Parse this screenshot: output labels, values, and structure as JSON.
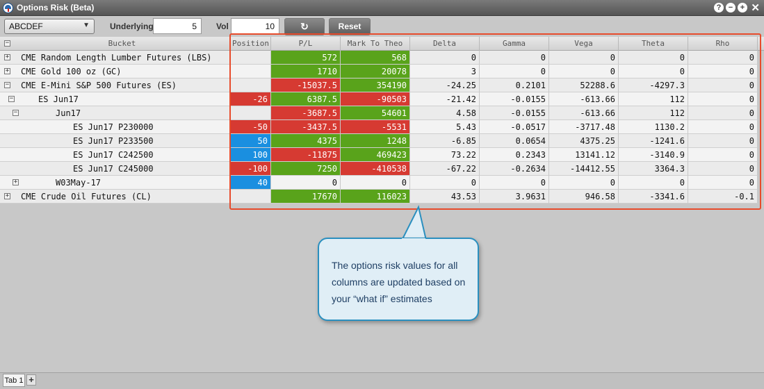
{
  "window": {
    "title": "Options Risk (Beta)",
    "help_icon": "?",
    "min_icon": "−",
    "max_icon": "+",
    "close_icon": "✕"
  },
  "toolbar": {
    "symbol_selected": "ABCDEF",
    "underlying_label": "Underlying",
    "underlying_value": "5",
    "vol_label": "Vol",
    "vol_value": "10",
    "refresh_icon": "↻",
    "reset_label": "Reset"
  },
  "grid": {
    "header_toggle": "−",
    "columns": [
      "Bucket",
      "Position",
      "P/L",
      "Mark To Theo",
      "Delta",
      "Gamma",
      "Vega",
      "Theta",
      "Rho"
    ],
    "rows": [
      {
        "label": "CME Random Length Lumber Futures (LBS)",
        "toggle": "+",
        "position": "",
        "pl": "572",
        "mtt": "568",
        "delta": "0",
        "gamma": "0",
        "vega": "0",
        "theta": "0",
        "rho": "0"
      },
      {
        "label": "CME Gold 100 oz (GC)",
        "toggle": "+",
        "position": "",
        "pl": "1710",
        "mtt": "20078",
        "delta": "3",
        "gamma": "0",
        "vega": "0",
        "theta": "0",
        "rho": "0"
      },
      {
        "label": "CME E-Mini S&P 500 Futures (ES)",
        "toggle": "−",
        "position": "",
        "pl": "-15037.5",
        "mtt": "354190",
        "delta": "-24.25",
        "gamma": "0.2101",
        "vega": "52288.6",
        "theta": "-4297.3",
        "rho": "0"
      },
      {
        "label": "ES Jun17",
        "toggle": "−",
        "position": "-26",
        "pl": "6387.5",
        "mtt": "-90503",
        "delta": "-21.42",
        "gamma": "-0.0155",
        "vega": "-613.66",
        "theta": "112",
        "rho": "0"
      },
      {
        "label": "Jun17",
        "toggle": "−",
        "position": "",
        "pl": "-3687.5",
        "mtt": "54601",
        "delta": "4.58",
        "gamma": "-0.0155",
        "vega": "-613.66",
        "theta": "112",
        "rho": "0"
      },
      {
        "label": "ES Jun17 P230000",
        "toggle": "",
        "position": "-50",
        "pl": "-3437.5",
        "mtt": "-5531",
        "delta": "5.43",
        "gamma": "-0.0517",
        "vega": "-3717.48",
        "theta": "1130.2",
        "rho": "0"
      },
      {
        "label": "ES Jun17 P233500",
        "toggle": "",
        "position": "50",
        "pl": "4375",
        "mtt": "1248",
        "delta": "-6.85",
        "gamma": "0.0654",
        "vega": "4375.25",
        "theta": "-1241.6",
        "rho": "0"
      },
      {
        "label": "ES Jun17 C242500",
        "toggle": "",
        "position": "100",
        "pl": "-11875",
        "mtt": "469423",
        "delta": "73.22",
        "gamma": "0.2343",
        "vega": "13141.12",
        "theta": "-3140.9",
        "rho": "0"
      },
      {
        "label": "ES Jun17 C245000",
        "toggle": "",
        "position": "-100",
        "pl": "7250",
        "mtt": "-410538",
        "delta": "-67.22",
        "gamma": "-0.2634",
        "vega": "-14412.55",
        "theta": "3364.3",
        "rho": "0"
      },
      {
        "label": "W03May-17",
        "toggle": "+",
        "position": "40",
        "pl": "0",
        "mtt": "0",
        "delta": "0",
        "gamma": "0",
        "vega": "0",
        "theta": "0",
        "rho": "0"
      },
      {
        "label": "CME Crude Oil Futures (CL)",
        "toggle": "+",
        "position": "",
        "pl": "17670",
        "mtt": "116023",
        "delta": "43.53",
        "gamma": "3.9631",
        "vega": "946.58",
        "theta": "-3341.6",
        "rho": "-0.1"
      }
    ]
  },
  "colors": {
    "positive": "#59a31b",
    "negative": "#d63a32",
    "long_position": "#1a8fe0",
    "highlight": "#e74b2b",
    "callout_border": "#2a8fbf"
  },
  "callout": {
    "text": "The options risk values for all columns are updated based on your “what if” estimates"
  },
  "tabs": {
    "active_label": "Tab 1",
    "add_icon": "+"
  }
}
